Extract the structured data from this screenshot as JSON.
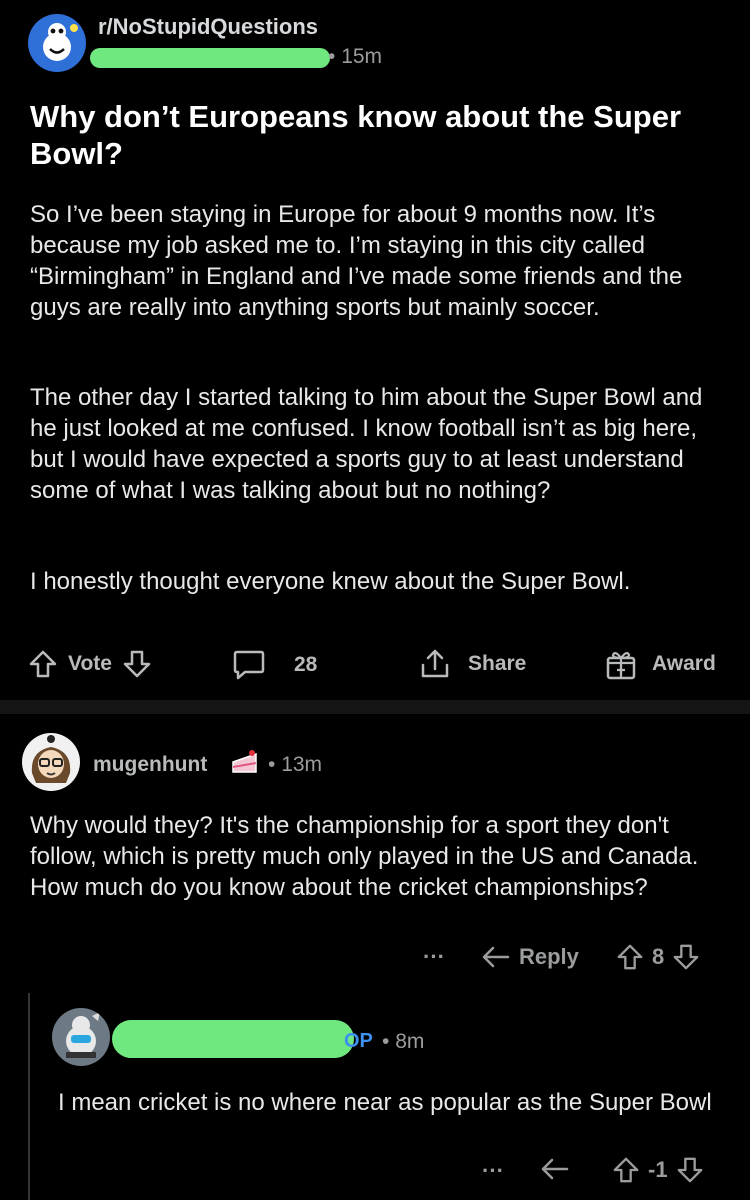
{
  "post": {
    "subreddit": "r/NoStupidQuestions",
    "time": "15m",
    "title": "Why don’t Europeans know about the Super Bowl?",
    "paragraphs": [
      "So I’ve been staying in Europe for about 9 months now. It’s because my job asked me to. I’m staying in this city called “Birmingham” in England and I’ve made some friends and the guys are really into anything sports but mainly soccer.",
      "The other day I started talking to him about the Super Bowl and he just looked at me confused. I know football isn’t as big here, but I would have expected a sports guy to at least understand some of what I was talking about but no nothing?",
      "I honestly thought everyone knew about the Super Bowl."
    ],
    "actions": {
      "vote_label": "Vote",
      "comment_count": "28",
      "share_label": "Share",
      "award_label": "Award"
    }
  },
  "comment1": {
    "username": "mugenhunt",
    "time": "13m",
    "text": "Why would they? It's the championship for a sport they don't follow, which is pretty much only played in the US and Canada. How much do you know about the cricket championships?",
    "more": "···",
    "reply_label": "Reply",
    "score": "8"
  },
  "comment2": {
    "op_badge": "OP",
    "time": "8m",
    "text": "I mean cricket is no where near as popular as the Super Bowl",
    "more": "···",
    "score": "-1"
  },
  "colors": {
    "background": "#000000",
    "redaction": "#6ee87f",
    "op_badge": "#3d8ff0",
    "text": "#d7dadc",
    "muted": "#9a9c9e"
  }
}
